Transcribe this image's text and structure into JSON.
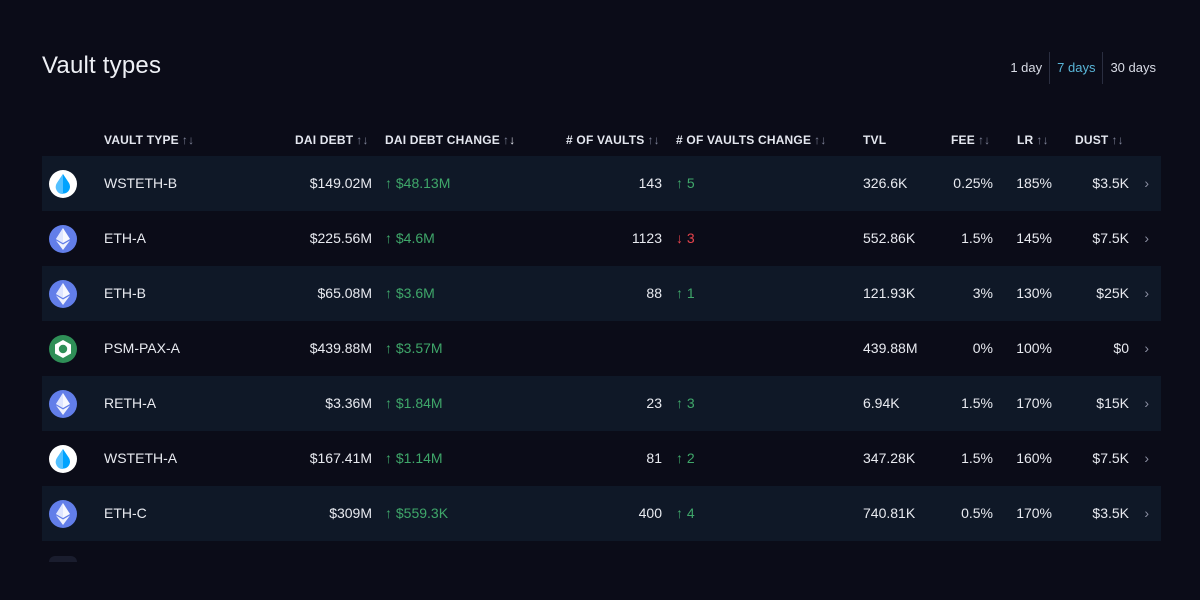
{
  "page": {
    "title": "Vault types"
  },
  "range": {
    "options": [
      "1 day",
      "7 days",
      "30 days"
    ],
    "active": "7 days"
  },
  "columns": {
    "vault_type": "VAULT TYPE",
    "dai_debt": "DAI DEBT",
    "dai_debt_change": "DAI DEBT CHANGE",
    "num_vaults": "# OF VAULTS",
    "num_vaults_change": "# OF VAULTS CHANGE",
    "tvl": "TVL",
    "fee": "FEE",
    "lr": "LR",
    "dust": "DUST"
  },
  "rows": [
    {
      "icon": "wsteth-drop-icon",
      "name": "WSTETH-B",
      "dai_debt": "$149.02M",
      "debt_change": "$48.13M",
      "debt_dir": "up",
      "vaults": "143",
      "vaults_change": "5",
      "vaults_dir": "up",
      "tvl": "326.6K",
      "fee": "0.25%",
      "lr": "185%",
      "dust": "$3.5K"
    },
    {
      "icon": "eth-icon",
      "name": "ETH-A",
      "dai_debt": "$225.56M",
      "debt_change": "$4.6M",
      "debt_dir": "up",
      "vaults": "1123",
      "vaults_change": "3",
      "vaults_dir": "down",
      "tvl": "552.86K",
      "fee": "1.5%",
      "lr": "145%",
      "dust": "$7.5K"
    },
    {
      "icon": "eth-icon",
      "name": "ETH-B",
      "dai_debt": "$65.08M",
      "debt_change": "$3.6M",
      "debt_dir": "up",
      "vaults": "88",
      "vaults_change": "1",
      "vaults_dir": "up",
      "tvl": "121.93K",
      "fee": "3%",
      "lr": "130%",
      "dust": "$25K"
    },
    {
      "icon": "pax-icon",
      "name": "PSM-PAX-A",
      "dai_debt": "$439.88M",
      "debt_change": "$3.57M",
      "debt_dir": "up",
      "vaults": "",
      "vaults_change": "",
      "vaults_dir": "",
      "tvl": "439.88M",
      "fee": "0%",
      "lr": "100%",
      "dust": "$0"
    },
    {
      "icon": "eth-icon",
      "name": "RETH-A",
      "dai_debt": "$3.36M",
      "debt_change": "$1.84M",
      "debt_dir": "up",
      "vaults": "23",
      "vaults_change": "3",
      "vaults_dir": "up",
      "tvl": "6.94K",
      "fee": "1.5%",
      "lr": "170%",
      "dust": "$15K"
    },
    {
      "icon": "wsteth-drop-icon",
      "name": "WSTETH-A",
      "dai_debt": "$167.41M",
      "debt_change": "$1.14M",
      "debt_dir": "up",
      "vaults": "81",
      "vaults_change": "2",
      "vaults_dir": "up",
      "tvl": "347.28K",
      "fee": "1.5%",
      "lr": "160%",
      "dust": "$7.5K"
    },
    {
      "icon": "eth-icon",
      "name": "ETH-C",
      "dai_debt": "$309M",
      "debt_change": "$559.3K",
      "debt_dir": "up",
      "vaults": "400",
      "vaults_change": "4",
      "vaults_dir": "up",
      "tvl": "740.81K",
      "fee": "0.5%",
      "lr": "170%",
      "dust": "$3.5K"
    }
  ],
  "colors": {
    "background": "#0b0c18",
    "row_alt": "#0f1827",
    "positive": "#3fa76a",
    "negative": "#e6434c",
    "active_range": "#59b6d8"
  }
}
